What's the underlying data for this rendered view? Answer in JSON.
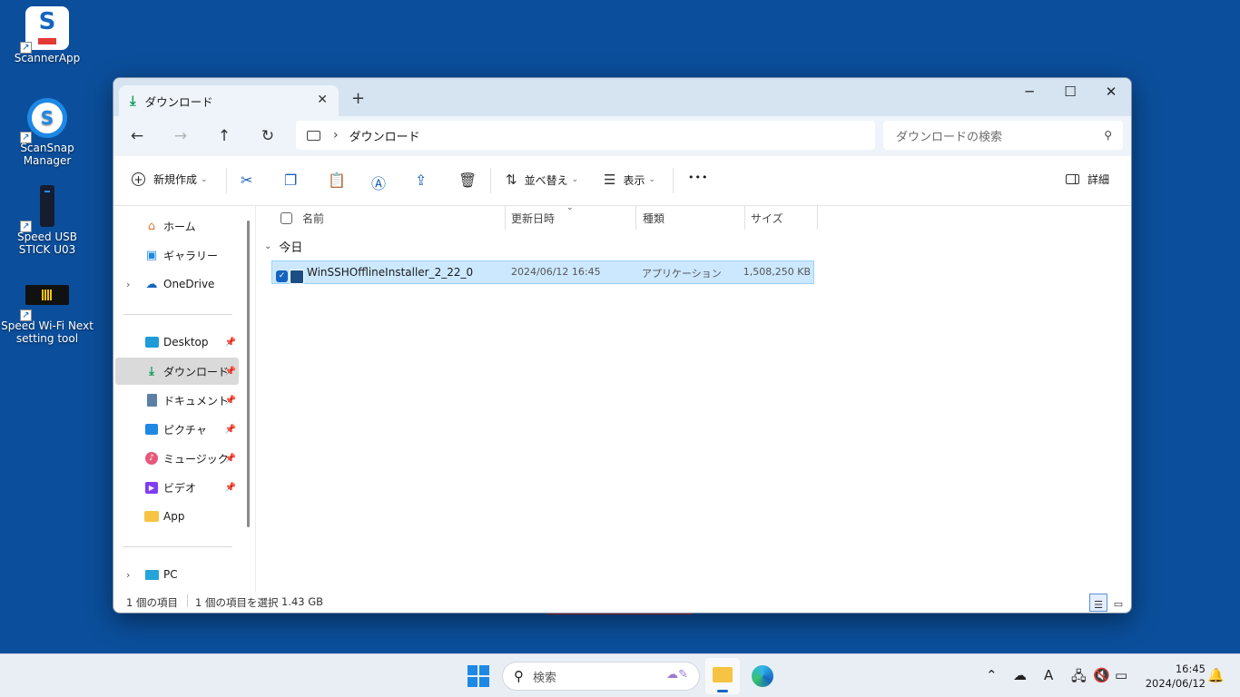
{
  "desktop": {
    "icons": [
      {
        "label": "ScannerApp"
      },
      {
        "label": "ScanSnap Manager"
      },
      {
        "label": "Speed USB STICK U03"
      },
      {
        "label": "Speed Wi-Fi Next setting tool"
      }
    ]
  },
  "window": {
    "tab_title": "ダウンロード",
    "new_tab": "+",
    "minimize": "─",
    "maximize": "☐",
    "close": "✕",
    "address": {
      "crumb": "ダウンロード",
      "separator": "›"
    },
    "search": {
      "placeholder": "ダウンロードの検索"
    },
    "toolbar": {
      "new_label": "新規作成",
      "sort_label": "並べ替え",
      "view_label": "表示",
      "more_label": "•••",
      "details_label": "詳細"
    },
    "sidebar": {
      "items": [
        {
          "label": "ホーム"
        },
        {
          "label": "ギャラリー"
        },
        {
          "label": "OneDrive"
        },
        {
          "label": "Desktop"
        },
        {
          "label": "ダウンロード"
        },
        {
          "label": "ドキュメント"
        },
        {
          "label": "ピクチャ"
        },
        {
          "label": "ミュージック"
        },
        {
          "label": "ビデオ"
        },
        {
          "label": "App"
        },
        {
          "label": "PC"
        }
      ]
    },
    "columns": {
      "name": "名前",
      "modified": "更新日時",
      "type": "種類",
      "size": "サイズ"
    },
    "group": "今日",
    "files": [
      {
        "name": "WinSSHOfflineInstaller_2_22_0",
        "modified": "2024/06/12 16:45",
        "type": "アプリケーション",
        "size": "1,508,250 KB"
      }
    ],
    "status": {
      "count": "1 個の項目",
      "selected": "1 個の項目を選択",
      "selected_size": "1.43 GB"
    }
  },
  "taskbar": {
    "search_label": "検索",
    "time": "16:45",
    "date": "2024/06/12"
  }
}
